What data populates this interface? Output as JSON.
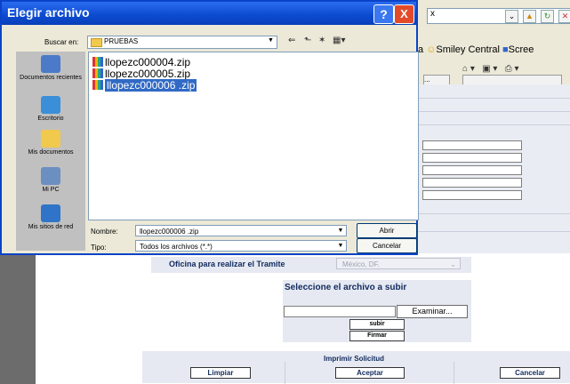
{
  "browser": {
    "address_suffix": "x",
    "links": [
      "a",
      "Smiley Central",
      "Scree"
    ],
    "input_hint": "..."
  },
  "form": {
    "oficina_label": "Oficina para realizar el Tramite",
    "oficina_value": "México, DF.",
    "upload_title": "Seleccione el archivo a subir",
    "examinar_label": "Examinar...",
    "subir_label": "subir",
    "firmar_label": "Firmar",
    "imprimir_label": "Imprimir Solicitud",
    "limpiar_label": "Limpiar",
    "aceptar_label": "Aceptar",
    "cancelar_label": "Cancelar"
  },
  "dialog": {
    "title": "Elegir archivo",
    "help": "?",
    "close": "X",
    "lookin_label": "Buscar en:",
    "lookin_value": "PRUEBAS",
    "places": [
      "Documentos recientes",
      "Escritorio",
      "Mis documentos",
      "Mi PC",
      "Mis sitios de red"
    ],
    "files": [
      {
        "name": "llopezc000004.zip",
        "selected": false
      },
      {
        "name": "llopezc000005.zip",
        "selected": false
      },
      {
        "name": "llopezc000006 .zip",
        "selected": true
      }
    ],
    "name_label": "Nombre:",
    "name_value": "llopezc000006 .zip",
    "type_label": "Tipo:",
    "type_value": "Todos los archivos (*.*)",
    "open_label": "Abrir",
    "cancel_label": "Cancelar"
  },
  "colors": {
    "title_blue": "#0b4ad0",
    "selection": "#316ac5",
    "dialog_bg": "#ece9d8",
    "form_band": "#e6e9f2"
  }
}
